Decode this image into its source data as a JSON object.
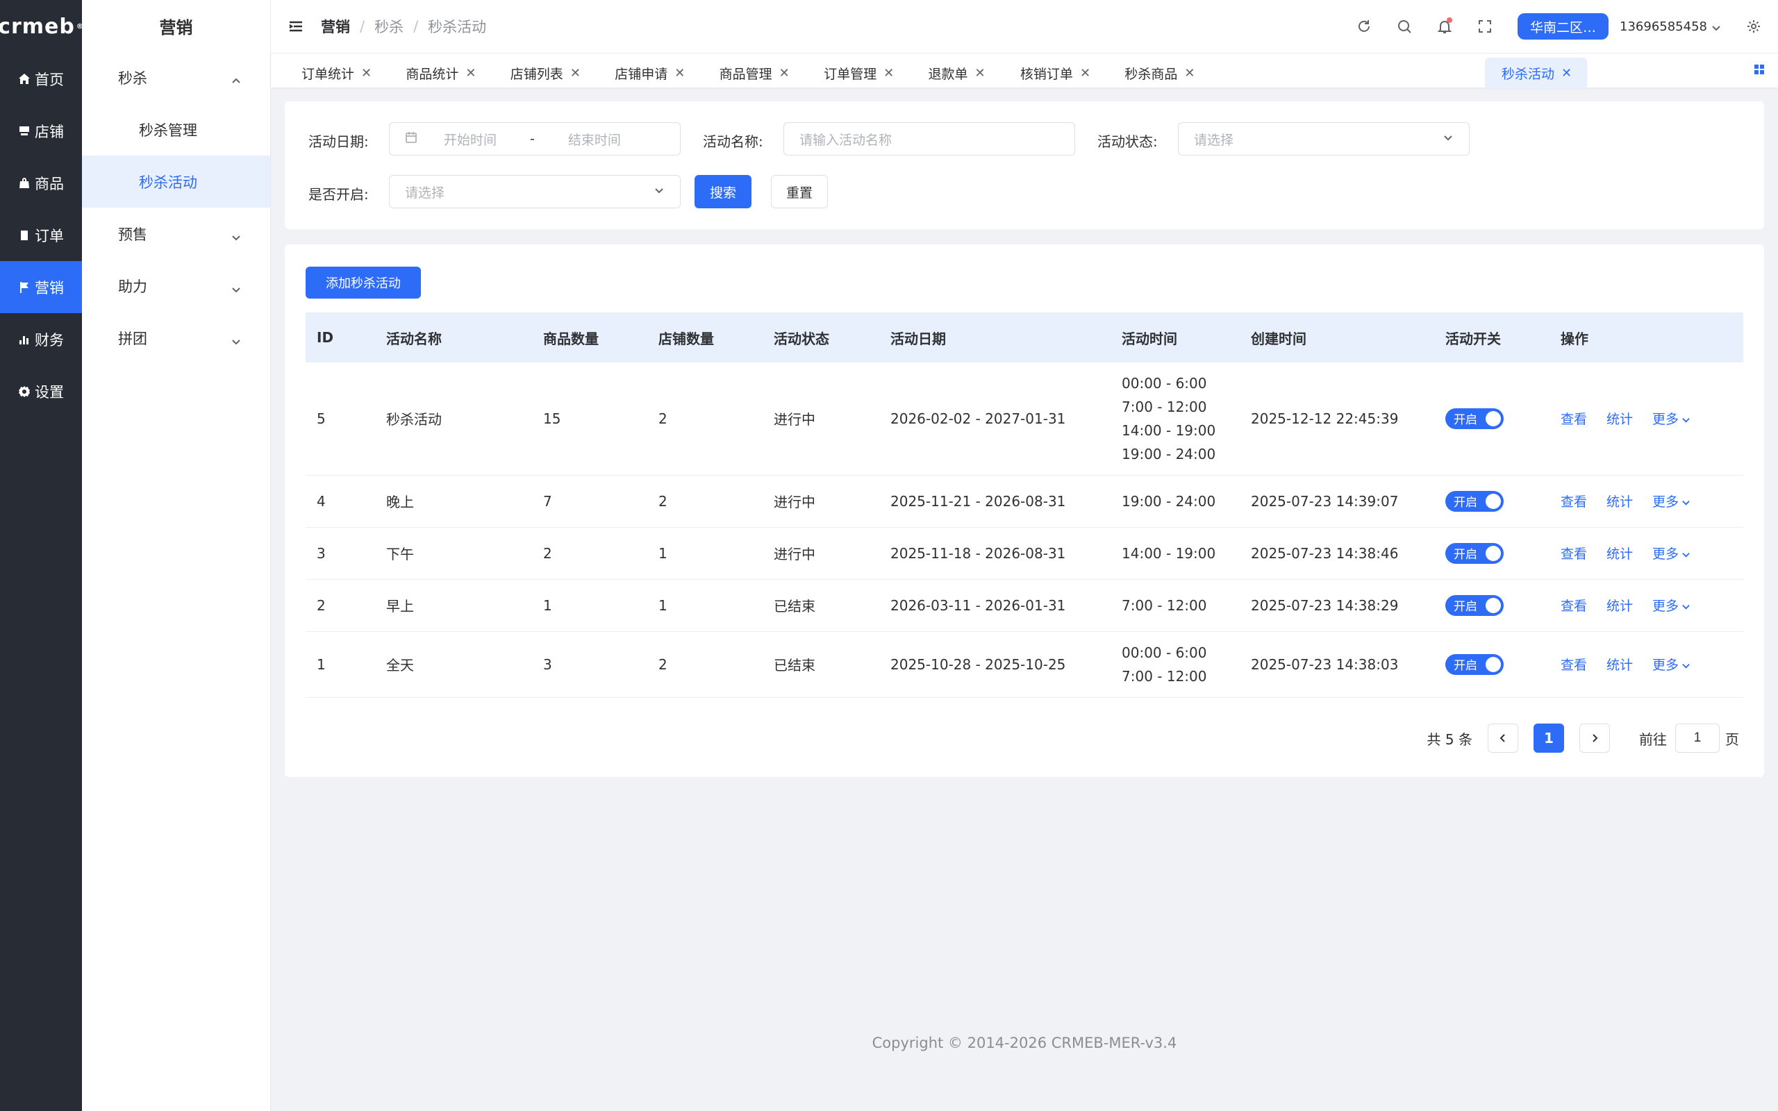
{
  "logo": "crmeb",
  "rail": [
    {
      "label": "首页",
      "icon": "home-icon"
    },
    {
      "label": "店铺",
      "icon": "shop-icon"
    },
    {
      "label": "商品",
      "icon": "bag-icon"
    },
    {
      "label": "订单",
      "icon": "clipboard-icon"
    },
    {
      "label": "营销",
      "icon": "flag-icon",
      "active": true
    },
    {
      "label": "财务",
      "icon": "bar-chart-icon"
    },
    {
      "label": "设置",
      "icon": "gear-icon"
    }
  ],
  "submenu": {
    "title": "营销",
    "seckill": "秒杀",
    "seckill_manage": "秒杀管理",
    "seckill_activity": "秒杀活动",
    "presale": "预售",
    "assist": "助力",
    "group": "拼团"
  },
  "header": {
    "breadcrumb": [
      "营销",
      "秒杀",
      "秒杀活动"
    ],
    "region": "华南二区…",
    "user": "13696585458"
  },
  "tabs": [
    "订单统计",
    "商品统计",
    "店铺列表",
    "店铺申请",
    "商品管理",
    "订单管理",
    "退款单",
    "核销订单",
    "秒杀商品",
    "秒杀活动"
  ],
  "filter": {
    "date_label": "活动日期:",
    "start_placeholder": "开始时间",
    "range_sep": "-",
    "end_placeholder": "结束时间",
    "name_label": "活动名称:",
    "name_placeholder": "请输入活动名称",
    "status_label": "活动状态:",
    "status_placeholder": "请选择",
    "open_label": "是否开启:",
    "open_placeholder": "请选择",
    "search": "搜索",
    "reset": "重置"
  },
  "add_button": "添加秒杀活动",
  "table": {
    "columns": [
      "ID",
      "活动名称",
      "商品数量",
      "店铺数量",
      "活动状态",
      "活动日期",
      "活动时间",
      "创建时间",
      "活动开关",
      "操作"
    ],
    "rows": [
      {
        "id": "5",
        "name": "秒杀活动",
        "goods": "15",
        "shops": "2",
        "status": "进行中",
        "date": "2026-02-02 - 2027-01-31",
        "times": [
          "00:00 - 6:00",
          "7:00 - 12:00",
          "14:00 - 19:00",
          "19:00 - 24:00"
        ],
        "created": "2025-12-12 22:45:39",
        "switch": "开启"
      },
      {
        "id": "4",
        "name": "晚上",
        "goods": "7",
        "shops": "2",
        "status": "进行中",
        "date": "2025-11-21 - 2026-08-31",
        "times": [
          "19:00 - 24:00"
        ],
        "created": "2025-07-23 14:39:07",
        "switch": "开启"
      },
      {
        "id": "3",
        "name": "下午",
        "goods": "2",
        "shops": "1",
        "status": "进行中",
        "date": "2025-11-18 - 2026-08-31",
        "times": [
          "14:00 - 19:00"
        ],
        "created": "2025-07-23 14:38:46",
        "switch": "开启"
      },
      {
        "id": "2",
        "name": "早上",
        "goods": "1",
        "shops": "1",
        "status": "已结束",
        "date": "2026-03-11 - 2026-01-31",
        "times": [
          "7:00 - 12:00"
        ],
        "created": "2025-07-23 14:38:29",
        "switch": "开启"
      },
      {
        "id": "1",
        "name": "全天",
        "goods": "3",
        "shops": "2",
        "status": "已结束",
        "date": "2025-10-28 - 2025-10-25",
        "times": [
          "00:00 - 6:00",
          "7:00 - 12:00"
        ],
        "created": "2025-07-23 14:38:03",
        "switch": "开启"
      }
    ],
    "ops": {
      "view": "查看",
      "stats": "统计",
      "more": "更多"
    }
  },
  "pager": {
    "total": "共 5 条",
    "current": "1",
    "goto": "前往",
    "page_value": "1",
    "page_unit": "页"
  },
  "footer": "Copyright © 2014-2026 CRMEB-MER-v3.4"
}
